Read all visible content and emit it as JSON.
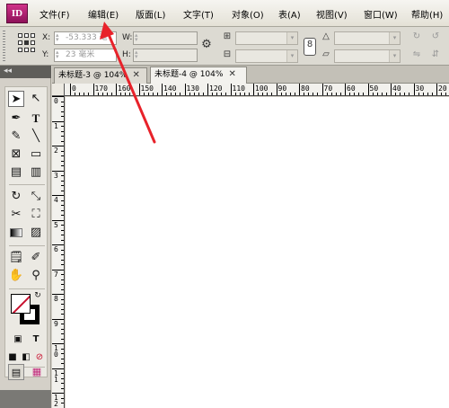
{
  "app": {
    "logo_text": "ID"
  },
  "menu": {
    "items": [
      {
        "label": "文件(F)"
      },
      {
        "label": "编辑(E)"
      },
      {
        "label": "版面(L)"
      },
      {
        "label": "文字(T)"
      },
      {
        "label": "对象(O)"
      },
      {
        "label": "表(A)"
      },
      {
        "label": "视图(V)"
      },
      {
        "label": "窗口(W)"
      },
      {
        "label": "帮助(H)"
      }
    ]
  },
  "control_panel": {
    "x_label": "X:",
    "x_value": "-53.333 毫",
    "y_label": "Y:",
    "y_value": "23 毫米",
    "w_label": "W:",
    "h_label": "H:"
  },
  "toolbox": {
    "collapse_glyph": "◂◂"
  },
  "tabs": [
    {
      "label": "未标题-3 @ 104%",
      "close": "✕",
      "active": false
    },
    {
      "label": "未标题-4 @ 104%",
      "close": "✕",
      "active": true
    }
  ],
  "rulers": {
    "horizontal": [
      "0",
      "170",
      "160",
      "150",
      "140",
      "130",
      "120",
      "110",
      "100",
      "90",
      "80",
      "70",
      "60",
      "50",
      "40",
      "30",
      "20"
    ],
    "vertical": [
      "0",
      "1",
      "2",
      "3",
      "4",
      "5",
      "6",
      "7",
      "8",
      "9",
      "10",
      "11",
      "12"
    ]
  },
  "annotation": {
    "arrow_color": "#e8222a",
    "points_to": "编辑(E)"
  },
  "colors": {
    "accent": "#c1267a",
    "stroke_swatch": "#c8102e",
    "canvas": "#ffffff"
  }
}
